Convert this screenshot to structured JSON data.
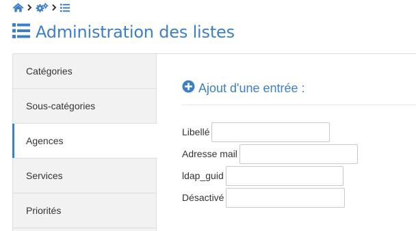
{
  "breadcrumb": {
    "items": [
      {
        "icon": "home-icon"
      },
      {
        "icon": "cogs-icon"
      },
      {
        "icon": "list-icon"
      }
    ],
    "separator_icon": "chevron-right-icon"
  },
  "page": {
    "title": "Administration des listes",
    "title_icon": "list-icon",
    "accent_color": "#3c7fc8"
  },
  "sidebar": {
    "active_index": 2,
    "items": [
      {
        "label": "Catégories"
      },
      {
        "label": "Sous-catégories"
      },
      {
        "label": "Agences"
      },
      {
        "label": "Services"
      },
      {
        "label": "Priorités"
      }
    ]
  },
  "content": {
    "section_title": "Ajout d'une entrée :",
    "section_icon": "plus-circle-icon",
    "form": {
      "fields": [
        {
          "label": "Libellé",
          "value": "",
          "placeholder": ""
        },
        {
          "label": "Adresse mail",
          "value": "",
          "placeholder": ""
        },
        {
          "label": "ldap_guid",
          "value": "",
          "placeholder": ""
        },
        {
          "label": "Désactivé",
          "value": "",
          "placeholder": ""
        }
      ]
    }
  }
}
